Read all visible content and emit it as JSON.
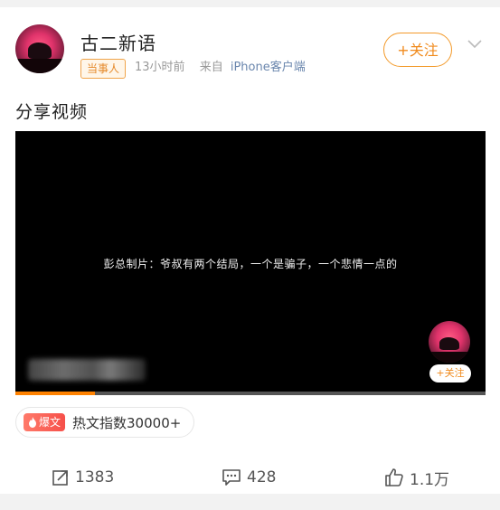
{
  "user": {
    "name": "古二新语",
    "badge": "当事人",
    "time": "13小时前",
    "source_prefix": "来自",
    "device": "iPhone客户端"
  },
  "follow": {
    "label": "+关注"
  },
  "post": {
    "text": "分享视频"
  },
  "video": {
    "subtitle": "彭总制片：爷叔有两个结局，一个是骗子，一个悲情一点的",
    "mini_follow": "+关注",
    "progress": 0.17
  },
  "hot": {
    "badge": "爆文",
    "label": "热文指数30000+"
  },
  "actions": {
    "repost": "1383",
    "comment": "428",
    "like": "1.1万"
  },
  "colors": {
    "accent": "#f08a1c",
    "link": "#6a86ad",
    "hot": "#f6504a"
  }
}
